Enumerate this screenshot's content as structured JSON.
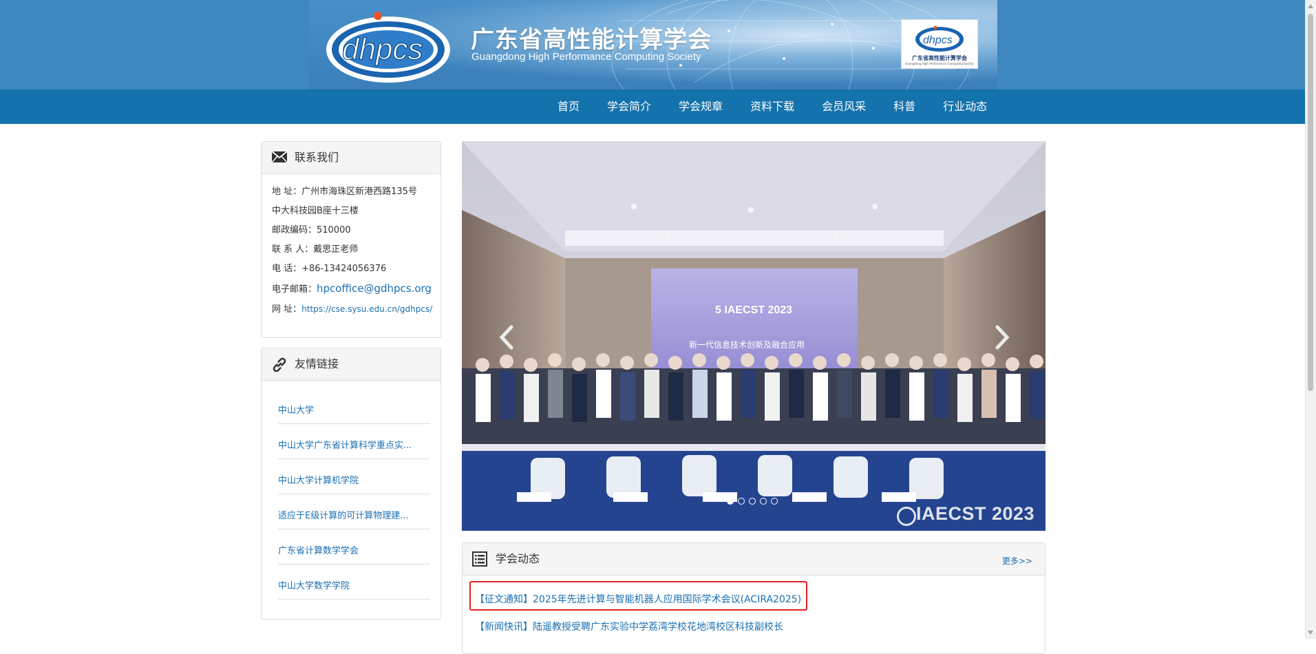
{
  "header": {
    "brand_cn": "广东省高性能计算学会",
    "brand_en": "Guangdong High Performance Computing Society",
    "logo_text": "dhpcs",
    "side_logo_cn": "广东省高性能计算学会",
    "side_logo_en": "Guangdong High Performance Computing Society"
  },
  "nav": {
    "items": [
      "首页",
      "学会简介",
      "学会规章",
      "资料下载",
      "会员风采",
      "科普",
      "行业动态"
    ]
  },
  "contact": {
    "title": "联系我们",
    "address_label": "地 址：",
    "address_line1": "广州市海珠区新港西路135号",
    "address_line2": "中大科技园B座十三楼",
    "postcode_label": "邮政编码：",
    "postcode": "510000",
    "person_label": "联 系 人：",
    "person": "戴思正老师",
    "phone_label": "电 话：",
    "phone": "+86-13424056376",
    "email_label": "电子邮箱：",
    "email": "hpcoffice@gdhpcs.org",
    "site_label": "网 址：",
    "site": "https://cse.sysu.edu.cn/gdhpcs/"
  },
  "links": {
    "title": "友情链接",
    "items": [
      "中山大学",
      "中山大学广东省计算科学重点实...",
      "中山大学计算机学院",
      "适应于E级计算的可计算物理建...",
      "广东省计算数学学会",
      "中山大学数学学院"
    ]
  },
  "carousel": {
    "watermark": "IAECST 2023",
    "screen_title": "5 IAECST 2023",
    "screen_subtitle": "新一代信息技术创新及融合应用",
    "active_index": 0,
    "slide_count": 5
  },
  "news": {
    "title": "学会动态",
    "more": "更多>>",
    "items": [
      "【征文通知】2025年先进计算与智能机器人应用国际学术会议(ACIRA2025)",
      "【新闻快讯】陆遥教授受聘广东实验中学荔湾学校花地湾校区科技副校长"
    ]
  },
  "colors": {
    "nav_bg": "#1472ac",
    "header_bg": "#3e87bf",
    "link": "#1a6fb3",
    "highlight": "#e02020"
  }
}
